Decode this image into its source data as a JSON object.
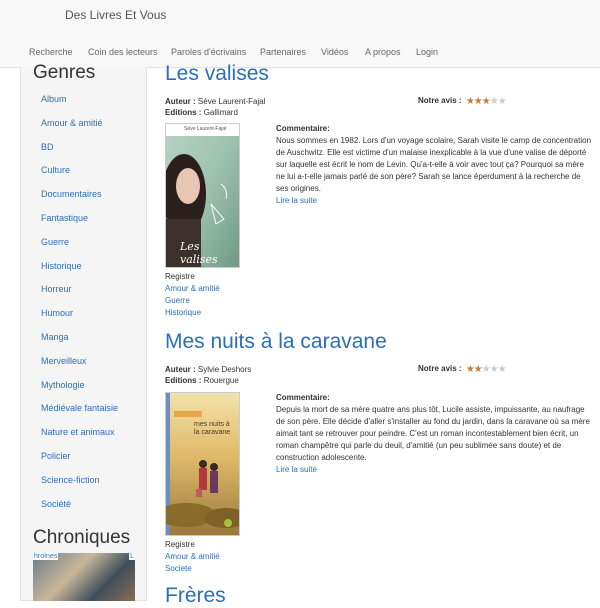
{
  "header": {
    "brand": "Des Livres Et Vous",
    "nav": [
      "Recherche",
      "Coin des lecteurs",
      "Paroles d'écrivains",
      "Partenaires",
      "Vidéos",
      "A propos",
      "Login"
    ]
  },
  "sidebar": {
    "genres_title": "Genres",
    "genres": [
      "Album",
      "Amour & amitié",
      "BD",
      "Culture",
      "Documentaires",
      "Fantastique",
      "Guerre",
      "Historique",
      "Horreur",
      "Humour",
      "Manga",
      "Merveilleux",
      "Mythologie",
      "Médiévale fantaisie",
      "Nature et animaux",
      "Policier",
      "Science-fiction",
      "Société"
    ],
    "chroniques_title": "Chroniques",
    "chroniques_thumb_text_left": "hroïnes",
    "chroniques_thumb_text_right": "L"
  },
  "labels": {
    "author": "Auteur :",
    "editions": "Editions :",
    "rating": "Notre avis :",
    "comment": "Commentaire:",
    "read_more": "Lire la suite",
    "register": "Registre"
  },
  "books": [
    {
      "title": "Les valises",
      "author": "Sève Laurent-Fajal",
      "editions": "Gallimard",
      "rating": 3,
      "rating_max": 5,
      "cover_author": "Sève Laurent-Fajal",
      "cover_title": "Les valises",
      "comment": "Nous sommes en 1982. Lors d'un voyage scolaire, Sarah visite le camp de concentration de Auschwitz. Elle est victime d'un malaise inexplicable à la vue d'une valise de déporté sur laquelle est écrit le nom de Levin. Qu'a-t-elle à voir avec tout ça? Pourquoi sa mère ne lui a-t-elle jamais parlé de son père? Sarah se lance éperdument à la recherche de ses origines.",
      "tags": [
        "Amour & amitié",
        "Guerre",
        "Historique"
      ]
    },
    {
      "title": "Mes nuits à la caravane",
      "author": "Sylvie Deshors",
      "editions": "Rouergue",
      "rating": 2,
      "rating_max": 5,
      "cover_author": "Sylvie Deshors",
      "cover_title": "mes nuits à la caravane",
      "comment": "Depuis la mort de sa mère quatre ans plus tôt, Lucile assiste, impuissante, au naufrage de son père. Elle décide d'aller s'installer au fond du jardin, dans la caravane où sa mère aimait tant se retrouver pour peindre. C'est un roman incontestablement bien écrit, un roman champêtre qui parle du deuil, d'amitié (un peu sublimée sans doute) et de construction adolescente.",
      "tags": [
        "Amour & amitié",
        "Societe"
      ]
    },
    {
      "title": "Frères"
    }
  ]
}
